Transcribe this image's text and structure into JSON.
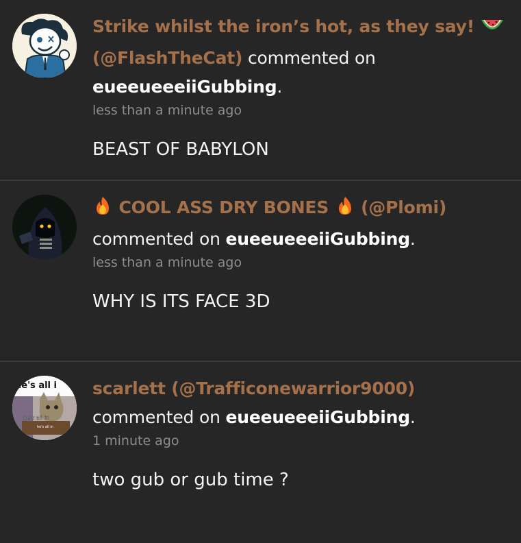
{
  "comments": [
    {
      "name_prefix": "Strike whilst the iron’s hot, as they say!",
      "name_emoji": "watermelon-emoji",
      "handle": "(@FlashTheCat)",
      "verb": "commented on",
      "target": "eueeueeeiiGubbing",
      "punct": ".",
      "time": "less than a minute ago",
      "body": "BEAST OF BABYLON",
      "avatar": "cartoon-character-avatar"
    },
    {
      "name": "COOL ASS DRY BONES",
      "name_emoji": "fire-emoji",
      "handle": "(@Plomi)",
      "verb": "commented on",
      "target": "eueeueeeiiGubbing",
      "punct": ".",
      "time": "less than a minute ago",
      "body": "WHY IS ITS FACE 3D",
      "avatar": "dark-hooded-figure-avatar"
    },
    {
      "name": "scarlett",
      "handle": "(@Trafficonewarrior9000)",
      "verb": "commented on",
      "target": "eueeueeeiiGubbing",
      "punct": ".",
      "time": "1 minute ago",
      "body": "two gub or gub time ?",
      "avatar": "cat-meme-avatar",
      "avatar_text_top": "he's all i",
      "avatar_text_mid": "he's all in",
      "avatar_text_bottom": "he's all in"
    }
  ],
  "colors": {
    "background": "#262626",
    "name": "#a5714b",
    "text": "#f2f2f2",
    "time": "#8d8d8d",
    "divider": "#3b3b3b"
  }
}
